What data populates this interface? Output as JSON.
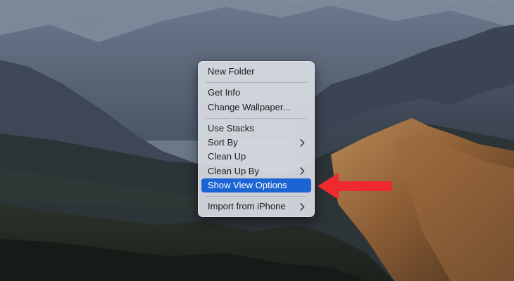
{
  "context_menu": {
    "groups": [
      {
        "items": [
          {
            "label": "New Folder"
          }
        ]
      },
      {
        "items": [
          {
            "label": "Get Info"
          },
          {
            "label": "Change Wallpaper..."
          }
        ]
      },
      {
        "items": [
          {
            "label": "Use Stacks"
          },
          {
            "label": "Sort By",
            "submenu": true
          },
          {
            "label": "Clean Up"
          },
          {
            "label": "Clean Up By",
            "submenu": true
          },
          {
            "label": "Show View Options",
            "highlighted": true
          }
        ]
      },
      {
        "items": [
          {
            "label": "Import from iPhone",
            "submenu": true
          }
        ]
      }
    ]
  },
  "annotation": {
    "arrow_color": "#ee2a2e",
    "points_to": "Show View Options"
  },
  "colors": {
    "highlight": "#1b64d4",
    "menu_background": "#d8dbe2",
    "menu_text": "#1c1c1e"
  },
  "icons": {
    "submenu": "chevron-right-icon",
    "annotation": "arrow-left-icon"
  }
}
